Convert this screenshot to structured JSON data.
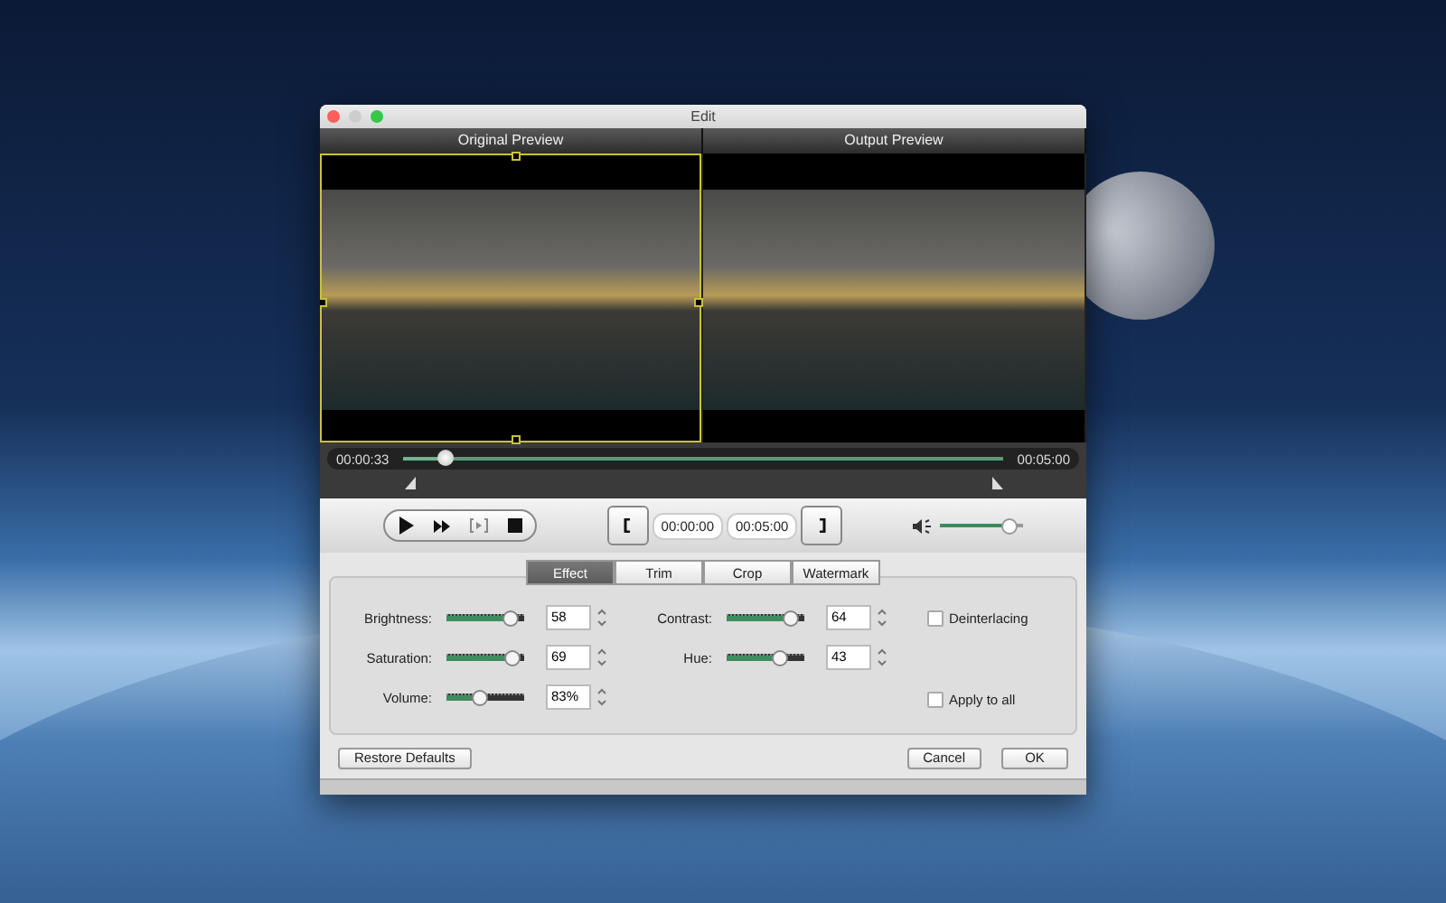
{
  "window": {
    "title": "Edit"
  },
  "previews": [
    {
      "label": "Original Preview",
      "selected": true
    },
    {
      "label": "Output Preview",
      "selected": false
    }
  ],
  "timeline": {
    "current_time": "00:00:33",
    "total_time": "00:05:00",
    "level": 0.07
  },
  "trim": {
    "start": "00:00:00",
    "end": "00:05:00"
  },
  "volume": {
    "level": 0.92
  },
  "tabs": [
    {
      "label": "Effect",
      "selected": true
    },
    {
      "label": "Trim",
      "selected": false
    },
    {
      "label": "Crop",
      "selected": false
    },
    {
      "label": "Watermark",
      "selected": false
    }
  ],
  "adjustments_left": [
    {
      "label": "Brightness:",
      "level": 0.78,
      "value": "58"
    },
    {
      "label": "Saturation:",
      "level": 0.82,
      "value": "69"
    },
    {
      "label": "Volume:",
      "level": 0.4,
      "value": "83%"
    }
  ],
  "adjustments_right": [
    {
      "label": "Contrast:",
      "level": 0.8,
      "value": "64"
    },
    {
      "label": "Hue:",
      "level": 0.66,
      "value": "43"
    }
  ],
  "options": [
    {
      "label": "Deinterlacing",
      "checked": false
    },
    {
      "label": "Apply to all",
      "checked": false
    }
  ],
  "buttons": {
    "restore": "Restore Defaults",
    "cancel": "Cancel",
    "ok": "OK"
  }
}
